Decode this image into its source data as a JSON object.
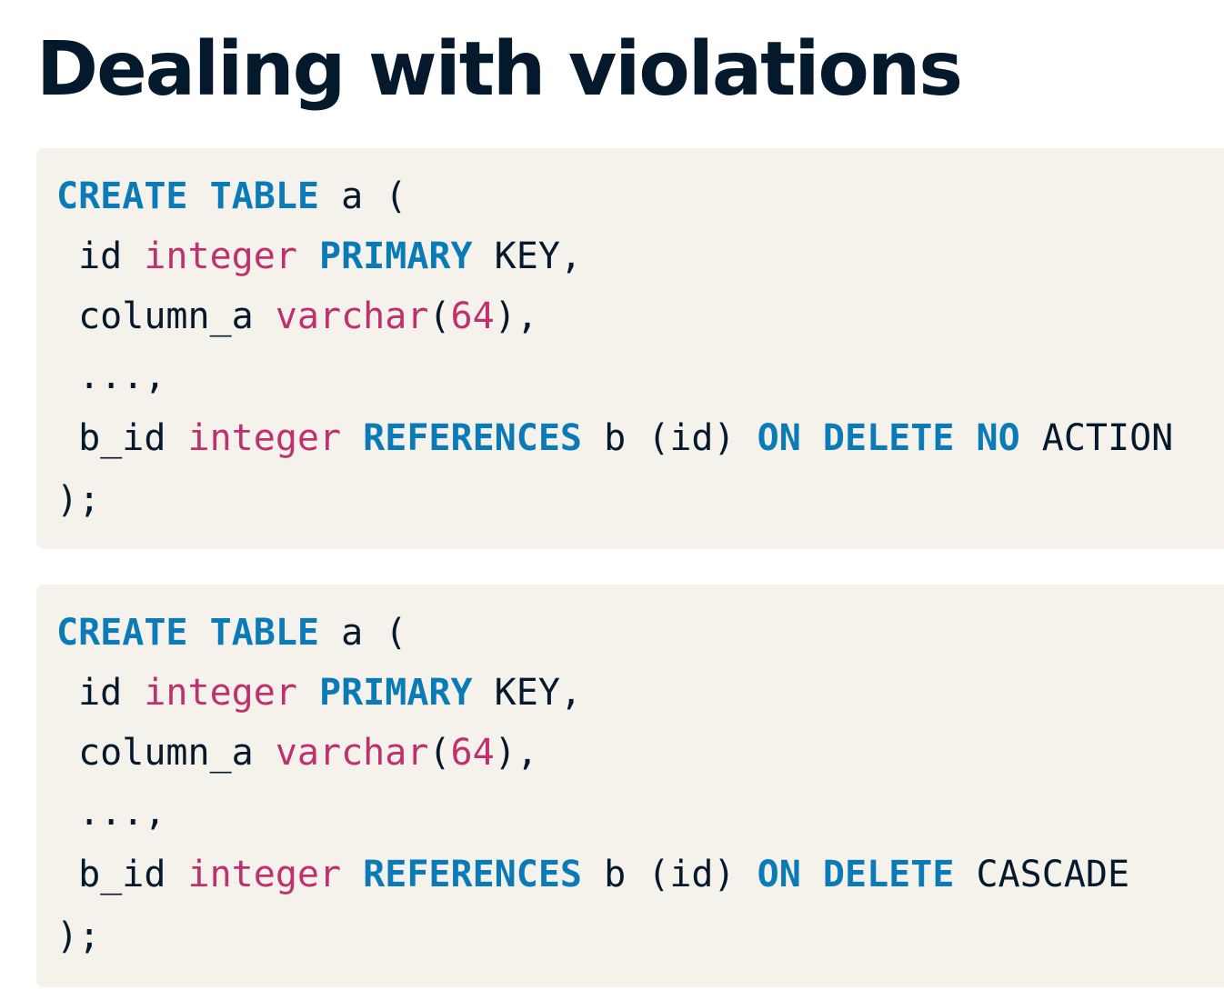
{
  "title": "Dealing with violations",
  "colors": {
    "keyword": "#0b7bb8",
    "type": "#c0306e",
    "text": "#05192d",
    "code_background": "#f5f2ec"
  },
  "code_blocks": [
    {
      "lines": [
        [
          {
            "t": "CREATE",
            "k": "kw"
          },
          {
            "t": " "
          },
          {
            "t": "TABLE",
            "k": "kw"
          },
          {
            "t": " a ("
          }
        ],
        [
          {
            "t": " id "
          },
          {
            "t": "integer",
            "k": "ty"
          },
          {
            "t": " "
          },
          {
            "t": "PRIMARY",
            "k": "kw"
          },
          {
            "t": " KEY,"
          }
        ],
        [
          {
            "t": " column_a "
          },
          {
            "t": "varchar",
            "k": "ty"
          },
          {
            "t": "("
          },
          {
            "t": "64",
            "k": "num"
          },
          {
            "t": "),"
          }
        ],
        [
          {
            "t": " ...,"
          }
        ],
        [
          {
            "t": " b_id "
          },
          {
            "t": "integer",
            "k": "ty"
          },
          {
            "t": " "
          },
          {
            "t": "REFERENCES",
            "k": "kw"
          },
          {
            "t": " b (id) "
          },
          {
            "t": "ON",
            "k": "kw"
          },
          {
            "t": " "
          },
          {
            "t": "DELETE",
            "k": "kw"
          },
          {
            "t": " "
          },
          {
            "t": "NO",
            "k": "kw"
          },
          {
            "t": " ACTION"
          }
        ],
        [
          {
            "t": ");"
          }
        ]
      ]
    },
    {
      "lines": [
        [
          {
            "t": "CREATE",
            "k": "kw"
          },
          {
            "t": " "
          },
          {
            "t": "TABLE",
            "k": "kw"
          },
          {
            "t": " a ("
          }
        ],
        [
          {
            "t": " id "
          },
          {
            "t": "integer",
            "k": "ty"
          },
          {
            "t": " "
          },
          {
            "t": "PRIMARY",
            "k": "kw"
          },
          {
            "t": " KEY,"
          }
        ],
        [
          {
            "t": " column_a "
          },
          {
            "t": "varchar",
            "k": "ty"
          },
          {
            "t": "("
          },
          {
            "t": "64",
            "k": "num"
          },
          {
            "t": "),"
          }
        ],
        [
          {
            "t": " ...,"
          }
        ],
        [
          {
            "t": " b_id "
          },
          {
            "t": "integer",
            "k": "ty"
          },
          {
            "t": " "
          },
          {
            "t": "REFERENCES",
            "k": "kw"
          },
          {
            "t": " b (id) "
          },
          {
            "t": "ON",
            "k": "kw"
          },
          {
            "t": " "
          },
          {
            "t": "DELETE",
            "k": "kw"
          },
          {
            "t": " CASCADE"
          }
        ],
        [
          {
            "t": ");"
          }
        ]
      ]
    }
  ]
}
